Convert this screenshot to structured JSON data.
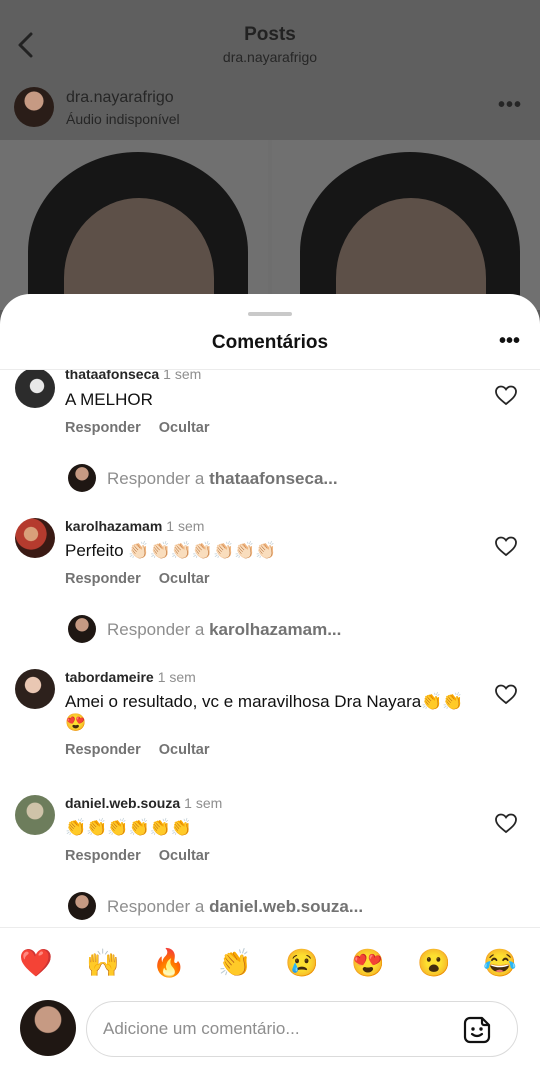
{
  "header": {
    "title": "Posts",
    "subtitle": "dra.nayarafrigo"
  },
  "post": {
    "author": "dra.nayarafrigo",
    "audio": "Áudio indisponível",
    "more": "•••"
  },
  "sheet": {
    "title": "Comentários",
    "more": "•••"
  },
  "comments": [
    {
      "username": "thataafonseca",
      "time": "1 sem",
      "text": "A MELHOR",
      "reply_label": "Responder",
      "hide_label": "Ocultar",
      "reply_prompt": "Responder a",
      "reply_user": "thataafonseca..."
    },
    {
      "username": "karolhazamam",
      "time": "1 sem",
      "text": "Perfeito 👏🏻👏🏻👏🏻👏🏻👏🏻👏🏻👏🏻",
      "reply_label": "Responder",
      "hide_label": "Ocultar",
      "reply_prompt": "Responder a",
      "reply_user": "karolhazamam..."
    },
    {
      "username": "tabordameire",
      "time": "1 sem",
      "text": "Amei o resultado, vc e maravilhosa Dra Nayara👏👏😍",
      "reply_label": "Responder",
      "hide_label": "Ocultar"
    },
    {
      "username": "daniel.web.souza",
      "time": "1 sem",
      "text": "👏👏👏👏👏👏",
      "reply_label": "Responder",
      "hide_label": "Ocultar",
      "reply_prompt": "Responder a",
      "reply_user": "daniel.web.souza..."
    }
  ],
  "quick_reactions": [
    "❤️",
    "🙌",
    "🔥",
    "👏",
    "😢",
    "😍",
    "😮",
    "😂"
  ],
  "composer": {
    "placeholder": "Adicione um comentário..."
  },
  "icons": {
    "back": "chevron-left-icon",
    "like": "heart-outline-icon",
    "sticker": "sticker-icon"
  }
}
